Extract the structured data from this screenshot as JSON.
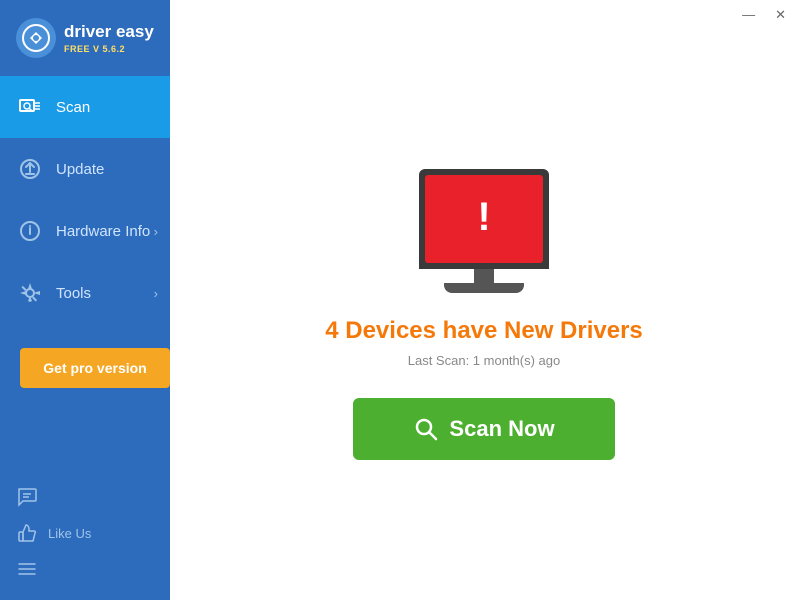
{
  "app": {
    "title": "driver easy",
    "version": "FREE V 5.6.2",
    "titlebar": {
      "minimize_label": "—",
      "close_label": "✕"
    }
  },
  "sidebar": {
    "items": [
      {
        "id": "scan",
        "label": "Scan",
        "active": true,
        "has_arrow": false
      },
      {
        "id": "update",
        "label": "Update",
        "active": false,
        "has_arrow": false
      },
      {
        "id": "hardware-info",
        "label": "Hardware Info",
        "active": false,
        "has_arrow": true
      },
      {
        "id": "tools",
        "label": "Tools",
        "active": false,
        "has_arrow": true
      }
    ],
    "get_pro_label": "Get pro version",
    "bottom": [
      {
        "id": "chat",
        "label": ""
      },
      {
        "id": "like-us",
        "label": "Like Us"
      },
      {
        "id": "menu",
        "label": ""
      }
    ]
  },
  "main": {
    "status_heading": "4 Devices have New Drivers",
    "last_scan": "Last Scan: 1 month(s) ago",
    "scan_button_label": "Scan Now"
  }
}
